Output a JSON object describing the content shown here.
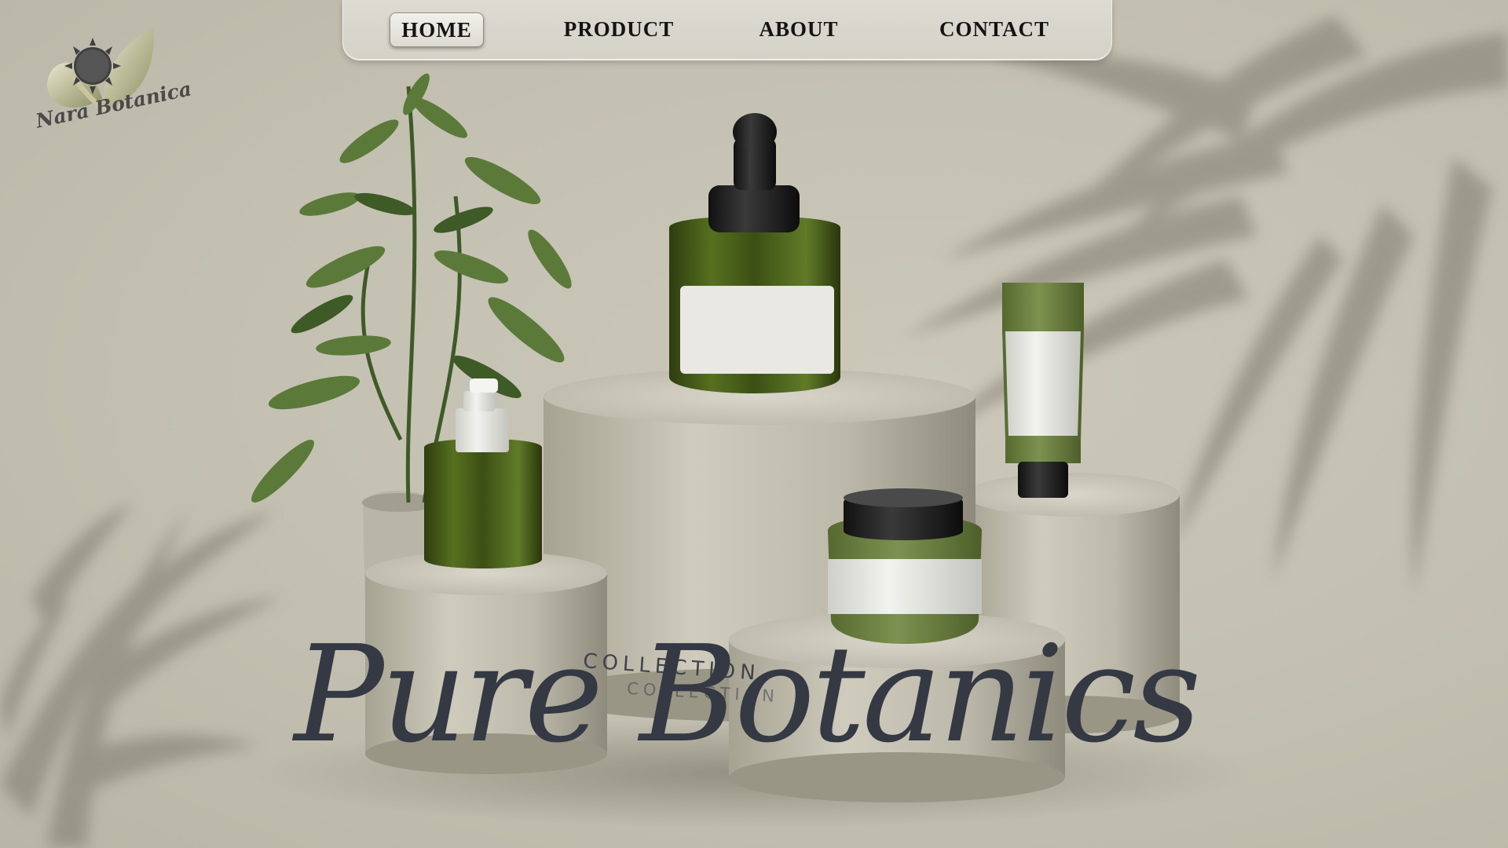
{
  "brand": {
    "logo_text": "Nara Botanica",
    "logo_icon": "sun-leaf-icon"
  },
  "nav": {
    "items": [
      {
        "label": "HOME",
        "active": true
      },
      {
        "label": "PRODUCT",
        "active": false
      },
      {
        "label": "ABOUT",
        "active": false
      },
      {
        "label": "CONTACT",
        "active": false
      }
    ]
  },
  "hero": {
    "collection_label": "COLLECTION",
    "title": "Pure Botanics"
  },
  "colors": {
    "background": "#c3c0b2",
    "product_green": "#4b5f22",
    "text_dark": "#343944"
  }
}
